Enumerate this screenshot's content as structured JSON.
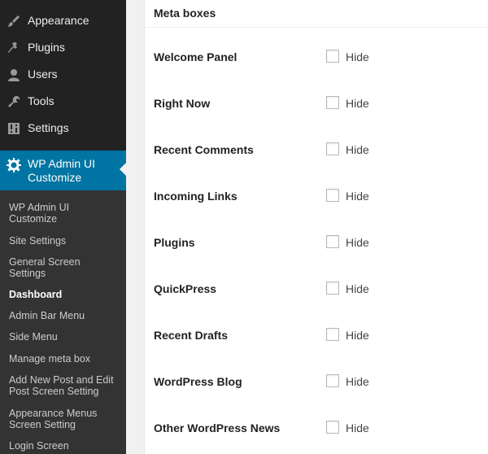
{
  "sidebar": {
    "top_items": [
      {
        "label": "Appearance",
        "icon": "paintbrush-icon"
      },
      {
        "label": "Plugins",
        "icon": "plug-icon"
      },
      {
        "label": "Users",
        "icon": "user-icon"
      },
      {
        "label": "Tools",
        "icon": "wrench-icon"
      },
      {
        "label": "Settings",
        "icon": "settings-icon"
      }
    ],
    "active_item": {
      "label": "WP Admin UI Customize",
      "icon": "gear-icon"
    },
    "submenu": [
      {
        "label": "WP Admin UI Customize",
        "current": false
      },
      {
        "label": "Site Settings",
        "current": false
      },
      {
        "label": "General Screen Settings",
        "current": false
      },
      {
        "label": "Dashboard",
        "current": true
      },
      {
        "label": "Admin Bar Menu",
        "current": false
      },
      {
        "label": "Side Menu",
        "current": false
      },
      {
        "label": "Manage meta box",
        "current": false
      },
      {
        "label": "Add New Post and Edit Post Screen Setting",
        "current": false
      },
      {
        "label": "Appearance Menus Screen Setting",
        "current": false
      },
      {
        "label": "Login Screen",
        "current": false
      }
    ]
  },
  "panel": {
    "title": "Meta boxes",
    "rows": [
      {
        "label": "Welcome Panel",
        "option": "Hide",
        "checked": false
      },
      {
        "label": "Right Now",
        "option": "Hide",
        "checked": false
      },
      {
        "label": "Recent Comments",
        "option": "Hide",
        "checked": false
      },
      {
        "label": "Incoming Links",
        "option": "Hide",
        "checked": false
      },
      {
        "label": "Plugins",
        "option": "Hide",
        "checked": false
      },
      {
        "label": "QuickPress",
        "option": "Hide",
        "checked": false
      },
      {
        "label": "Recent Drafts",
        "option": "Hide",
        "checked": false
      },
      {
        "label": "WordPress Blog",
        "option": "Hide",
        "checked": false
      },
      {
        "label": "Other WordPress News",
        "option": "Hide",
        "checked": false
      }
    ]
  },
  "colors": {
    "sidebar_bg": "#222222",
    "submenu_bg": "#333333",
    "active_bg": "#0074a2",
    "content_bg": "#f1f1f1"
  }
}
